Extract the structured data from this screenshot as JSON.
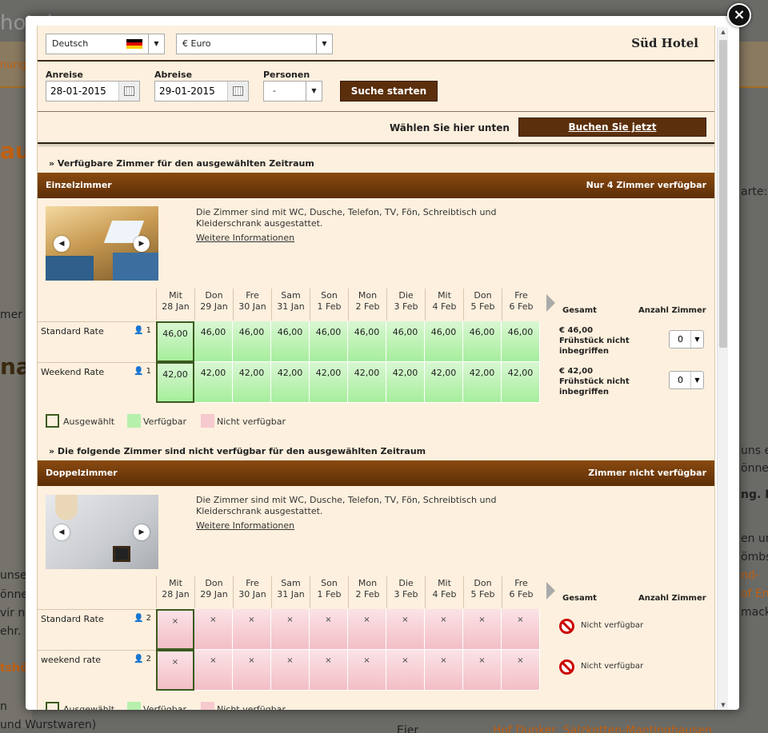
{
  "background": {
    "fragments": [
      "hotel",
      "nung",
      "au",
      "mer",
      "nal,",
      "unse",
      "önne",
      "vir ni",
      "ehr.",
      "tshö",
      "n",
      "und Wurstwaren)",
      "arte:",
      "uns ei",
      "önne",
      "ng. Da",
      "en un",
      "ömbs",
      "nd-",
      "of Eng",
      "mack",
      "Eier",
      "Hof Dunker, Salzkotten-Mantinghausen"
    ]
  },
  "close_label": "×",
  "header": {
    "language": "Deutsch",
    "currency": "€ Euro",
    "hotel_name": "Süd Hotel"
  },
  "search": {
    "arrival_label": "Anreise",
    "arrival_value": "28-01-2015",
    "departure_label": "Abreise",
    "departure_value": "29-01-2015",
    "persons_label": "Personen",
    "persons_value": "-",
    "search_button": "Suche starten"
  },
  "booking": {
    "prompt": "Wählen Sie hier unten",
    "book_button": "Buchen Sie jetzt"
  },
  "available_heading": "» Verfügbare Zimmer für den ausgewählten Zeitraum",
  "unavailable_heading": "» Die folgende Zimmer sind nicht verfügbar für den ausgewählten Zeitraum",
  "columns": {
    "total": "Gesamt",
    "rooms_count": "Anzahl Zimmer",
    "days": [
      {
        "d": "Mit",
        "date": "28 Jan"
      },
      {
        "d": "Don",
        "date": "29 Jan"
      },
      {
        "d": "Fre",
        "date": "30 Jan"
      },
      {
        "d": "Sam",
        "date": "31 Jan"
      },
      {
        "d": "Son",
        "date": "1 Feb"
      },
      {
        "d": "Mon",
        "date": "2 Feb"
      },
      {
        "d": "Die",
        "date": "3 Feb"
      },
      {
        "d": "Mit",
        "date": "4 Feb"
      },
      {
        "d": "Don",
        "date": "5 Feb"
      },
      {
        "d": "Fre",
        "date": "6 Feb"
      }
    ]
  },
  "rooms": [
    {
      "name": "Einzelzimmer",
      "availability": "Nur 4 Zimmer verfügbar",
      "description": "Die Zimmer sind mit WC, Dusche, Telefon, TV, Fön, Schreibtisch und Kleiderschrank ausgestattet.",
      "more_info": "Weitere Informationen",
      "rates": [
        {
          "name": "Standard Rate",
          "occupancy": "1",
          "prices": [
            "46,00",
            "46,00",
            "46,00",
            "46,00",
            "46,00",
            "46,00",
            "46,00",
            "46,00",
            "46,00",
            "46,00"
          ],
          "total": "€ 46,00",
          "note": "Frühstück nicht inbegriffen",
          "qty": "0"
        },
        {
          "name": "Weekend Rate",
          "occupancy": "1",
          "prices": [
            "42,00",
            "42,00",
            "42,00",
            "42,00",
            "42,00",
            "42,00",
            "42,00",
            "42,00",
            "42,00",
            "42,00"
          ],
          "total": "€ 42,00",
          "note": "Frühstück nicht inbegriffen",
          "qty": "0"
        }
      ]
    },
    {
      "name": "Doppelzimmer",
      "availability": "Zimmer nicht verfügbar",
      "description": "Die Zimmer sind mit WC, Dusche, Telefon, TV, Fön, Schreibtisch und Kleiderschrank ausgestattet.",
      "more_info": "Weitere Informationen",
      "rates": [
        {
          "name": "Standard Rate",
          "occupancy": "2",
          "cells": [
            "×",
            "×",
            "×",
            "×",
            "×",
            "×",
            "×",
            "×",
            "×",
            "×"
          ],
          "status": "Nicht verfügbar"
        },
        {
          "name": "weekend rate",
          "occupancy": "2",
          "cells": [
            "×",
            "×",
            "×",
            "×",
            "×",
            "×",
            "×",
            "×",
            "×",
            "×"
          ],
          "status": "Nicht verfügbar"
        }
      ]
    }
  ],
  "legend": {
    "selected": "Ausgewählt",
    "available": "Verfügbar",
    "unavailable": "Nicht verfügbar"
  },
  "colors": {
    "header_brown": "#5b2f0c",
    "available_green": "#a6ee9c",
    "unavailable_pink": "#f3bec6",
    "panel_bg": "#fdf0de"
  }
}
